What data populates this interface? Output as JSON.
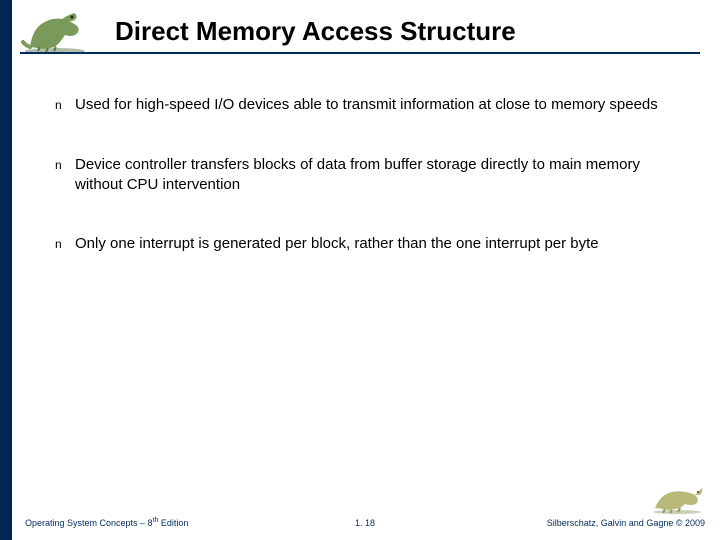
{
  "header": {
    "title": "Direct Memory Access Structure"
  },
  "bullets": [
    {
      "marker": "n",
      "text": "Used for high-speed I/O devices able to transmit information at close to memory speeds"
    },
    {
      "marker": "n",
      "text": "Device controller transfers blocks of data from buffer storage directly to main memory without CPU intervention"
    },
    {
      "marker": "n",
      "text": "Only one interrupt is generated per block, rather than the one interrupt per byte"
    }
  ],
  "footer": {
    "left_prefix": "Operating System Concepts – 8",
    "left_suffix_sup": "th",
    "left_suffix": " Edition",
    "center": "1. 18",
    "right": "Silberschatz, Galvin and Gagne © 2009"
  }
}
